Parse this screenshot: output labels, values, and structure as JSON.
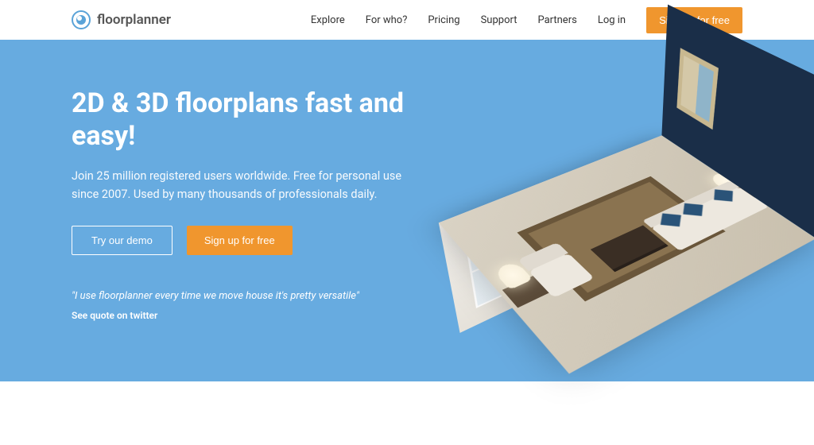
{
  "brand": "floorplanner",
  "nav": {
    "explore": "Explore",
    "forwho": "For who?",
    "pricing": "Pricing",
    "support": "Support",
    "partners": "Partners",
    "login": "Log in",
    "signup": "Sign up for free"
  },
  "hero": {
    "title": "2D & 3D floorplans fast and easy!",
    "subtitle": "Join 25 million registered users worldwide. Free for personal use since 2007. Used by many thousands of professionals daily.",
    "demo_btn": "Try our demo",
    "signup_btn": "Sign up for free",
    "quote": "\"I use floorplanner every time we move house it's pretty versatile\"",
    "quote_link": "See quote on twitter"
  }
}
